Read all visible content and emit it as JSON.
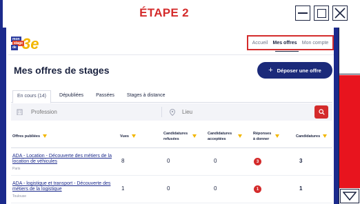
{
  "banner": {
    "step_title": "ÉTAPE 2"
  },
  "header": {
    "logo": {
      "line1": "mon",
      "line2": "stage",
      "line3": "de",
      "big": "3e"
    },
    "nav": [
      {
        "label": "Accueil",
        "active": false
      },
      {
        "label": "Mes offres",
        "active": true
      },
      {
        "label": "Mon compte",
        "active": false
      }
    ]
  },
  "main": {
    "title": "Mes offres de stages",
    "deposit_button": {
      "icon": "plus-icon",
      "label": "Déposer une offre"
    },
    "tabs": [
      {
        "label": "En cours (14)",
        "active": true
      },
      {
        "label": "Dépubliées",
        "active": false
      },
      {
        "label": "Passées",
        "active": false
      },
      {
        "label": "Stages à distance",
        "active": false
      }
    ],
    "search": {
      "profession_placeholder": "Profession",
      "location_placeholder": "Lieu"
    },
    "table": {
      "columns": [
        "Offres publiées",
        "Vues",
        "Candidatures refusées",
        "Candidatures acceptées",
        "Réponses à donner",
        "Candidatures"
      ],
      "rows": [
        {
          "title": "ADA - Location - Découverte des métiers de la location de véhicules",
          "city": "Paris",
          "views": "8",
          "refused": "0",
          "accepted": "0",
          "to_answer": "3",
          "applications": "3"
        },
        {
          "title": "ADA - logistique et transport - Découverte des métiers de la logistique",
          "city": "Toulouse",
          "views": "1",
          "refused": "0",
          "accepted": "0",
          "to_answer": "1",
          "applications": "1"
        }
      ]
    }
  },
  "colors": {
    "accent_red": "#d42b2b",
    "navy": "#1b2a7a",
    "sort_arrow": "#f2b600"
  }
}
